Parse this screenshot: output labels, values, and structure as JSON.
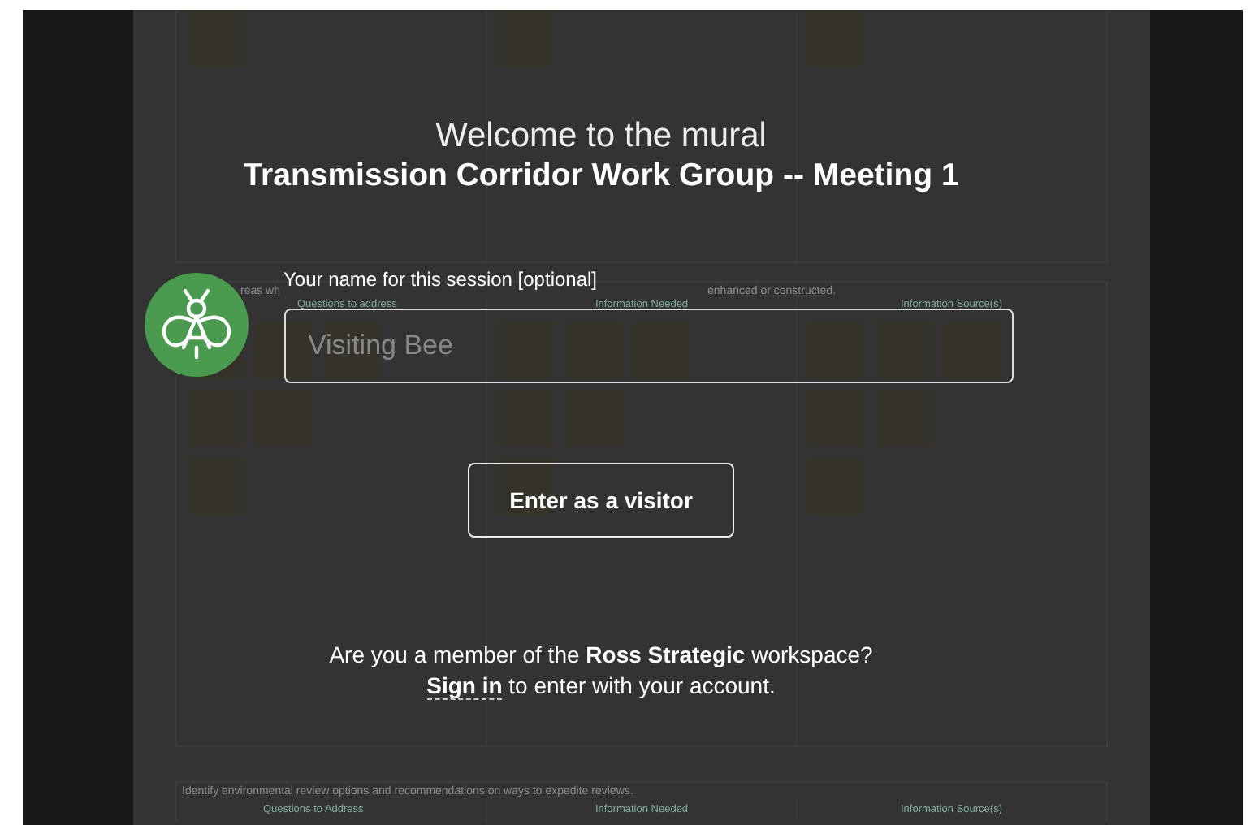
{
  "board": {
    "sections": [
      {
        "columns": [
          {},
          {},
          {}
        ]
      },
      {
        "header": "reas wh",
        "header_end": "enhanced or constructed.",
        "columns": [
          {
            "label": "Questions to address"
          },
          {
            "label": "Information Needed"
          },
          {
            "label": "Information Source(s)"
          }
        ]
      },
      {
        "header": "Identify environmental review options and recommendations on ways to expedite reviews.",
        "columns": [
          {
            "label": "Questions to Address"
          },
          {
            "label": "Information Needed"
          },
          {
            "label": "Information Source(s)"
          }
        ]
      }
    ]
  },
  "modal": {
    "welcome": "Welcome to the mural",
    "mural_title": "Transmission Corridor Work Group -- Meeting 1",
    "name_label": "Your name for this session [optional]",
    "name_field": {
      "placeholder": "Visiting Bee"
    },
    "enter_button": "Enter as a visitor",
    "member_prompt": "Are you a member of the **Ross Strategic** workspace?",
    "sign_in_link": "Sign in",
    "sign_in_text": "to enter with your account."
  }
}
